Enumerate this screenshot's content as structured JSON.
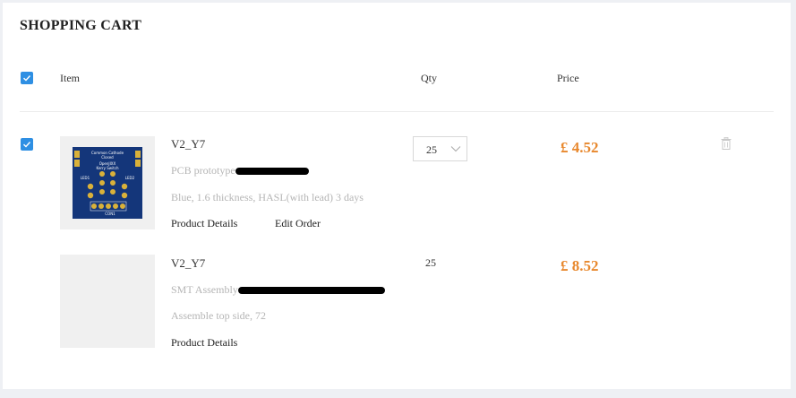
{
  "cart": {
    "title": "SHOPPING CART",
    "select_all_checked": true,
    "columns": {
      "item": "Item",
      "qty": "Qty",
      "price": "Price"
    }
  },
  "items": [
    {
      "checked": true,
      "name": "V2_Y7",
      "type": "PCB prototype",
      "spec": "Blue, 1.6 thickness, HASL(with lead) 3 days",
      "links": [
        "Product Details",
        "Edit Order"
      ],
      "qty": "25",
      "price": "£ 4.52",
      "board_text": [
        "Common Cathode",
        "Closed",
        "OpenJIXX",
        "Kerry Switch",
        "LED1",
        "LED2",
        "CON1"
      ]
    },
    {
      "name": "V2_Y7",
      "type": "SMT Assembly",
      "spec": "Assemble top side, 72",
      "links": [
        "Product Details"
      ],
      "qty": "25",
      "price": "£ 8.52"
    }
  ],
  "colors": {
    "accent": "#2e8fe3",
    "price": "#e8882d",
    "muted_text": "#b5b5b5",
    "pcb_blue": "#14367a",
    "pcb_gold": "#d9b13a"
  },
  "icons": {
    "delete": "trash-icon",
    "dropdown": "chevron-down-icon",
    "check": "check-icon"
  }
}
